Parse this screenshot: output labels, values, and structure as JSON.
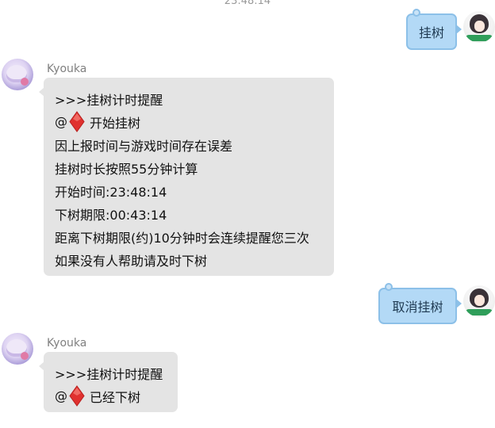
{
  "timestamp": "23:48:14",
  "messages": [
    {
      "direction": "outgoing",
      "text": "挂树"
    },
    {
      "direction": "incoming",
      "sender": "Kyouka",
      "lines": [
        {
          "text": ">>>挂树计时提醒"
        },
        {
          "prefix": "@",
          "icon": "red-diamond-icon",
          "text": "开始挂树"
        },
        {
          "text": "因上报时间与游戏时间存在误差"
        },
        {
          "text": "挂树时长按照55分钟计算"
        },
        {
          "text": "开始时间:23:48:14"
        },
        {
          "text": "下树期限:00:43:14"
        },
        {
          "text": "距离下树期限(约)10分钟时会连续提醒您三次"
        },
        {
          "text": "如果没有人帮助请及时下树"
        }
      ]
    },
    {
      "direction": "outgoing",
      "text": "取消挂树"
    },
    {
      "direction": "incoming",
      "sender": "Kyouka",
      "lines": [
        {
          "text": ">>>挂树计时提醒"
        },
        {
          "prefix": "@",
          "icon": "red-diamond-icon",
          "text": "已经下树"
        }
      ]
    }
  ],
  "colors": {
    "incoming_bubble": "#e4e4e4",
    "outgoing_bubble": "#b3d9f6",
    "outgoing_border": "#8cc0e8",
    "diamond": "#e0312f",
    "sender_name": "#808080"
  }
}
